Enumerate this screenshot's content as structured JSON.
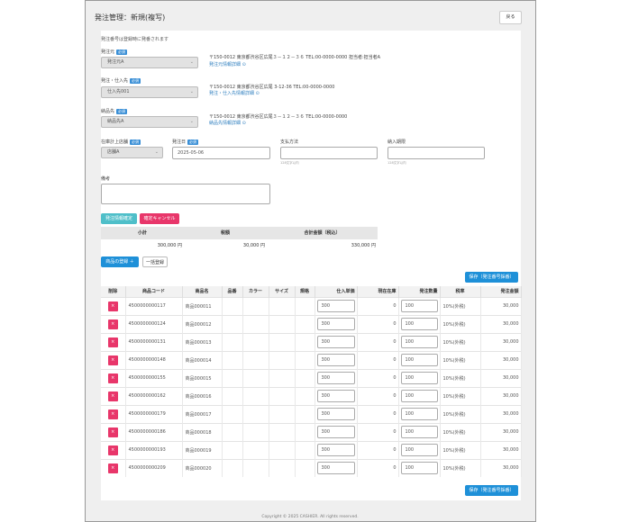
{
  "page": {
    "title": "発注管理：新規(複写)",
    "back_label": "戻る",
    "note": "発注番号は登録時に発番されます",
    "copyright": "Copyright © 2025 CASHIER. All rights reserved."
  },
  "form": {
    "required_badge": "必須",
    "supplier": {
      "label": "発注元",
      "value": "発注元A",
      "address": "〒150-0012 東京都渋谷区広尾３－１２－３６ TEL:00-0000-0000 担当者:担当者A",
      "link": "発注元情報詳細"
    },
    "vendor": {
      "label": "発注・仕入先",
      "value": "仕入先001",
      "address": "〒150-0012 東京都渋谷区広尾 3-12-36 TEL:00-0000-0000",
      "link": "発注・仕入先情報詳細"
    },
    "delivery": {
      "label": "納品先",
      "value": "納品先A",
      "address": "〒150-0012 東京都渋谷区広尾３－１２－３６ TEL:00-0000-0000",
      "link": "納品先情報詳細"
    },
    "store": {
      "label": "在庫計上店舗",
      "value": "店舗A"
    },
    "order_date": {
      "label": "発注日",
      "value": "2025-05-06"
    },
    "payment": {
      "label": "支払方法",
      "value": "",
      "hint": "128文字以内"
    },
    "delivery_terms": {
      "label": "納入期限",
      "value": "",
      "hint": "128文字以内"
    },
    "remarks": {
      "label": "備考",
      "value": ""
    }
  },
  "buttons": {
    "confirm": "発注情報確定",
    "cancel": "確定キャンセル",
    "add_product": "商品の登録 ＋",
    "bulk": "一括登録",
    "save": "保存（発注番号採番）"
  },
  "summary": {
    "headers": [
      "小計",
      "税額",
      "合計金額（税込）"
    ],
    "values": [
      "300,000 円",
      "30,000 円",
      "330,000 円"
    ]
  },
  "table": {
    "headers": [
      "削除",
      "商品コード",
      "商品名",
      "品番",
      "カラー",
      "サイズ",
      "規格",
      "仕入単価",
      "現在在庫",
      "発注数量",
      "税率",
      "発注金額"
    ],
    "rows": [
      {
        "code": "4500000000117",
        "name": "商品000011",
        "price": "300",
        "stock": "0",
        "qty": "100",
        "tax": "10%(外税)",
        "amount": "30,000"
      },
      {
        "code": "4500000000124",
        "name": "商品000012",
        "price": "300",
        "stock": "0",
        "qty": "100",
        "tax": "10%(外税)",
        "amount": "30,000"
      },
      {
        "code": "4500000000131",
        "name": "商品000013",
        "price": "300",
        "stock": "0",
        "qty": "100",
        "tax": "10%(外税)",
        "amount": "30,000"
      },
      {
        "code": "4500000000148",
        "name": "商品000014",
        "price": "300",
        "stock": "0",
        "qty": "100",
        "tax": "10%(外税)",
        "amount": "30,000"
      },
      {
        "code": "4500000000155",
        "name": "商品000015",
        "price": "300",
        "stock": "0",
        "qty": "100",
        "tax": "10%(外税)",
        "amount": "30,000"
      },
      {
        "code": "4500000000162",
        "name": "商品000016",
        "price": "300",
        "stock": "0",
        "qty": "100",
        "tax": "10%(外税)",
        "amount": "30,000"
      },
      {
        "code": "4500000000179",
        "name": "商品000017",
        "price": "300",
        "stock": "0",
        "qty": "100",
        "tax": "10%(外税)",
        "amount": "30,000"
      },
      {
        "code": "4500000000186",
        "name": "商品000018",
        "price": "300",
        "stock": "0",
        "qty": "100",
        "tax": "10%(外税)",
        "amount": "30,000"
      },
      {
        "code": "4500000000193",
        "name": "商品000019",
        "price": "300",
        "stock": "0",
        "qty": "100",
        "tax": "10%(外税)",
        "amount": "30,000"
      },
      {
        "code": "4500000000209",
        "name": "商品000020",
        "price": "300",
        "stock": "0",
        "qty": "100",
        "tax": "10%(外税)",
        "amount": "30,000"
      }
    ]
  },
  "colors": {
    "primary": "#1e90d8",
    "teal": "#4fbfc9",
    "pink": "#e8366a"
  }
}
